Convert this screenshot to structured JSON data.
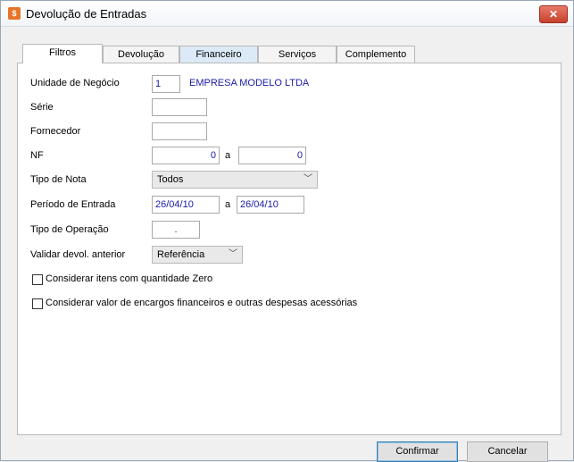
{
  "window": {
    "title": "Devolução de Entradas",
    "close_glyph": "✕",
    "app_icon": "app-icon"
  },
  "tabs": [
    {
      "label": "Filtros"
    },
    {
      "label": "Devolução"
    },
    {
      "label": "Financeiro"
    },
    {
      "label": "Serviços"
    },
    {
      "label": "Complemento"
    }
  ],
  "form": {
    "unidade": {
      "label": "Unidade de Negócio",
      "code": "1",
      "name": "EMPRESA MODELO LTDA"
    },
    "serie": {
      "label": "Série",
      "value": ""
    },
    "fornecedor": {
      "label": "Fornecedor",
      "value": ""
    },
    "nf": {
      "label": "NF",
      "from": "0",
      "sep": "a",
      "to": "0"
    },
    "tipo_nota": {
      "label": "Tipo de Nota",
      "value": "Todos"
    },
    "periodo": {
      "label": "Período de Entrada",
      "from": "26/04/10",
      "sep": "a",
      "to": "26/04/10"
    },
    "tipo_operacao": {
      "label": "Tipo de Operação",
      "value": "."
    },
    "validar": {
      "label": "Validar devol. anterior",
      "value": "Referência"
    },
    "chk_qtd_zero": {
      "label": "Considerar itens com quantidade Zero",
      "checked": false
    },
    "chk_encargos": {
      "label": "Considerar valor de encargos financeiros e outras despesas acessórias",
      "checked": false
    }
  },
  "buttons": {
    "confirmar": "Confirmar",
    "cancelar": "Cancelar"
  }
}
